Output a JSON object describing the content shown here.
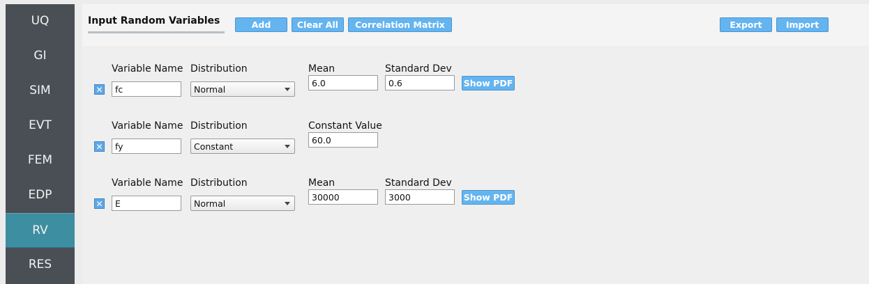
{
  "sidebar": {
    "items": [
      {
        "label": "UQ"
      },
      {
        "label": "GI"
      },
      {
        "label": "SIM"
      },
      {
        "label": "EVT"
      },
      {
        "label": "FEM"
      },
      {
        "label": "EDP"
      },
      {
        "label": "RV"
      },
      {
        "label": "RES"
      }
    ],
    "active": "RV"
  },
  "header": {
    "title": "Input Random Variables",
    "add_label": "Add",
    "clear_label": "Clear All",
    "corr_label": "Correlation Matrix",
    "export_label": "Export",
    "import_label": "Import"
  },
  "variables": [
    {
      "name_label": "Variable Name",
      "name": "fc",
      "dist_label": "Distribution",
      "distribution": "Normal",
      "p1_label": "Mean",
      "p1": "6.0",
      "p2_label": "Standard Dev",
      "p2": "0.6",
      "pdf_label": "Show PDF"
    },
    {
      "name_label": "Variable Name",
      "name": "fy",
      "dist_label": "Distribution",
      "distribution": "Constant",
      "p1_label": "Constant Value",
      "p1": "60.0"
    },
    {
      "name_label": "Variable Name",
      "name": "E",
      "dist_label": "Distribution",
      "distribution": "Normal",
      "p1_label": "Mean",
      "p1": "30000",
      "p2_label": "Standard Dev",
      "p2": "3000",
      "pdf_label": "Show PDF"
    }
  ],
  "colors": {
    "sidebar_bg": "#4a4f55",
    "sidebar_active": "#3d8ea0",
    "button_blue": "#64b4f0",
    "checkbox_blue": "#5fa8e6"
  },
  "icons": {
    "checkbox": "x-checkbox-icon",
    "dropdown": "chevron-down-icon"
  }
}
